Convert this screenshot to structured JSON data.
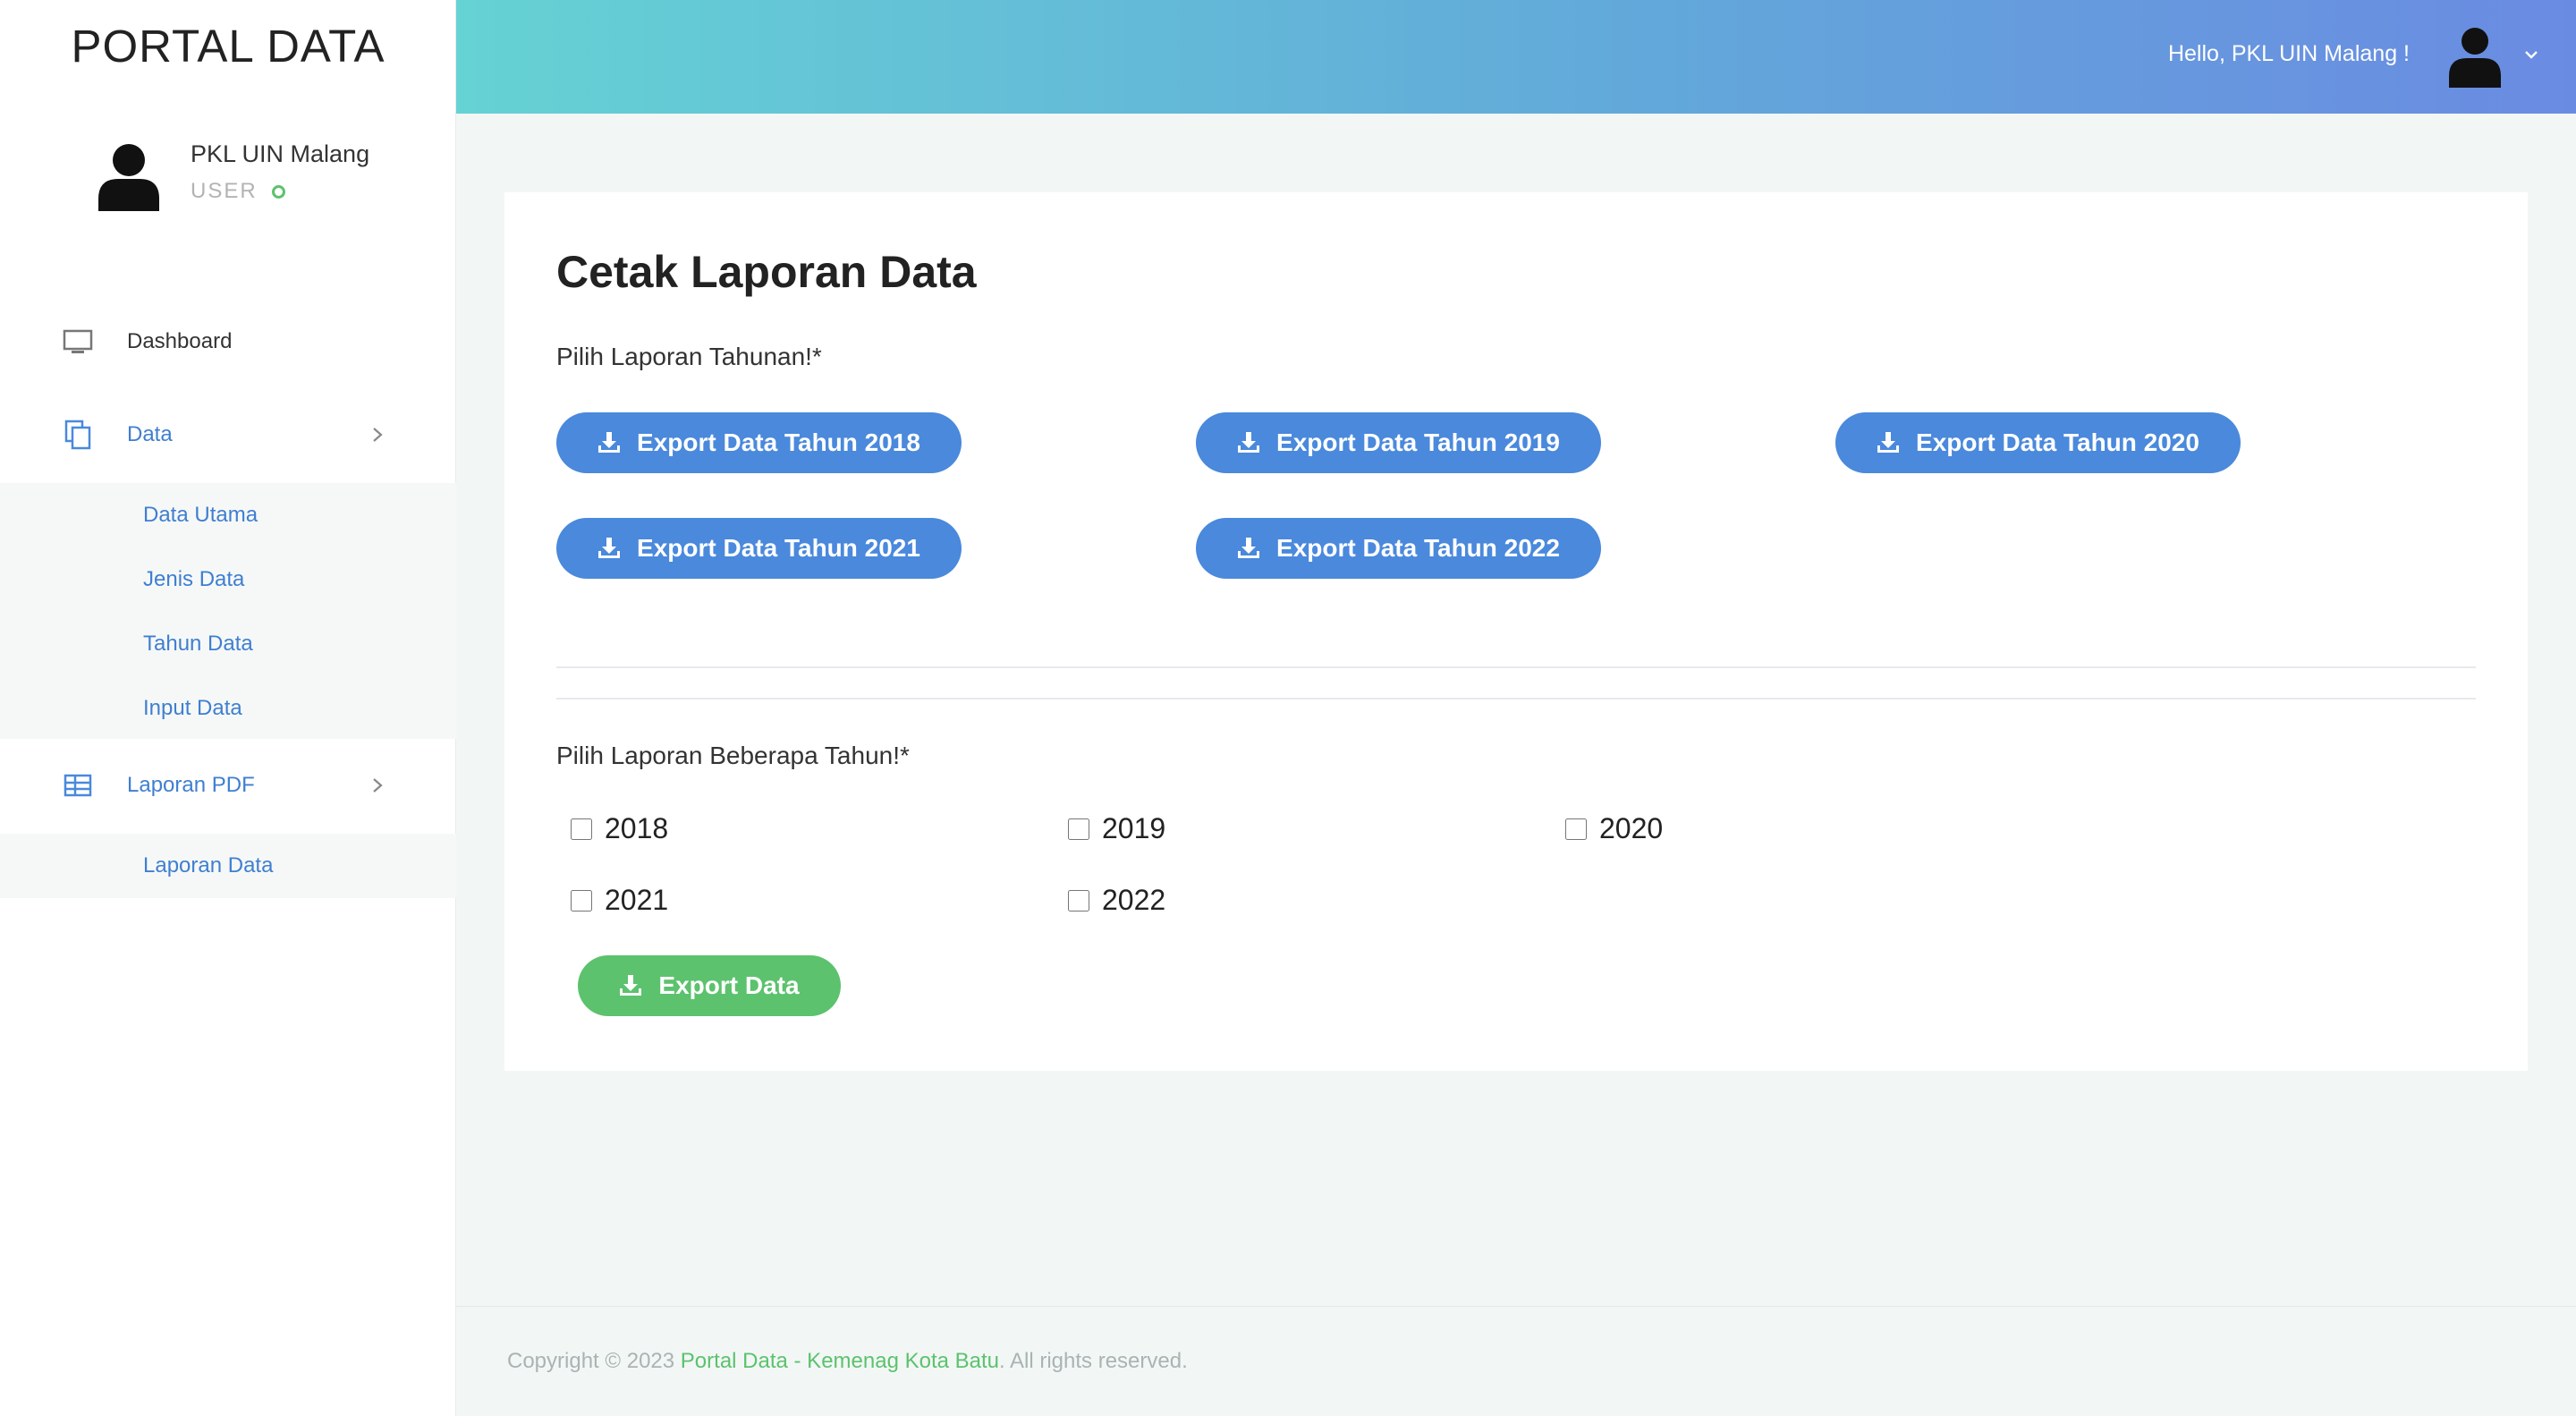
{
  "sidebar": {
    "brand": "PORTAL DATA",
    "profile": {
      "name": "PKL UIN Malang",
      "role": "USER"
    },
    "nav": {
      "dashboard": "Dashboard",
      "data": "Data",
      "data_sub": [
        "Data Utama",
        "Jenis Data",
        "Tahun Data",
        "Input Data"
      ],
      "laporan": "Laporan PDF",
      "laporan_sub": [
        "Laporan Data"
      ]
    }
  },
  "header": {
    "greeting": "Hello, PKL UIN Malang !"
  },
  "main": {
    "title": "Cetak Laporan Data",
    "yearly_label": "Pilih Laporan Tahunan!*",
    "yearly_buttons": [
      "Export Data Tahun 2018",
      "Export Data Tahun 2019",
      "Export Data Tahun 2020",
      "Export Data Tahun 2021",
      "Export Data Tahun 2022"
    ],
    "multi_label": "Pilih Laporan Beberapa Tahun!*",
    "years": [
      "2018",
      "2019",
      "2020",
      "2021",
      "2022"
    ],
    "export_button": "Export Data"
  },
  "footer": {
    "prefix": "Copyright © 2023 ",
    "link": "Portal Data - Kemenag Kota Batu",
    "suffix": ". All rights reserved."
  },
  "colors": {
    "accent_blue": "#4a89dc",
    "accent_green": "#5cc26d",
    "header_gradient_start": "#65d2d4",
    "header_gradient_end": "#6a8be2"
  }
}
